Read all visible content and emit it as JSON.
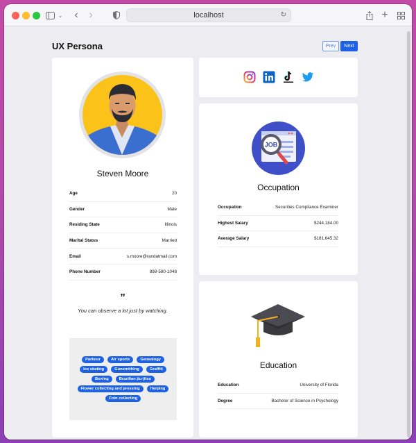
{
  "browser": {
    "address": "localhost"
  },
  "page": {
    "title": "UX Persona",
    "prev_label": "Prev",
    "next_label": "Next"
  },
  "persona": {
    "name": "Steven Moore",
    "details": [
      {
        "label": "Age",
        "value": "20"
      },
      {
        "label": "Gender",
        "value": "Male"
      },
      {
        "label": "Residing State",
        "value": "Illinois"
      },
      {
        "label": "Marital Status",
        "value": "Married"
      },
      {
        "label": "Email",
        "value": "s.moore@randatmail.com"
      },
      {
        "label": "Phone Number",
        "value": "898-580-1048"
      }
    ],
    "quote_mark": "”",
    "quote": "You can observe a lot just by watching.",
    "interests": [
      "Parkour",
      "Air sports",
      "Genealogy",
      "Ice skating",
      "Gunsmithing",
      "Graffiti",
      "Boxing",
      "Brazilian jiu-jitsu",
      "Flower collecting and pressing",
      "Herping",
      "Coin collecting"
    ]
  },
  "socials": [
    "instagram-icon",
    "linkedin-icon",
    "tiktok-icon",
    "twitter-icon"
  ],
  "occupation": {
    "title": "Occupation",
    "image_text": "JOB",
    "rows": [
      {
        "label": "Occupation",
        "value": "Securities Compliance Examiner"
      },
      {
        "label": "Highest Salary",
        "value": "$244,184.00"
      },
      {
        "label": "Average Salary",
        "value": "$181,645.32"
      }
    ]
  },
  "education": {
    "title": "Education",
    "rows": [
      {
        "label": "Education",
        "value": "University of Florida"
      },
      {
        "label": "Degree",
        "value": "Bachelor of Science in Psychology"
      }
    ]
  },
  "colors": {
    "accent": "#1d62e6",
    "avatar_bg": "#fbc21a",
    "window_bg": "#ededf1"
  }
}
